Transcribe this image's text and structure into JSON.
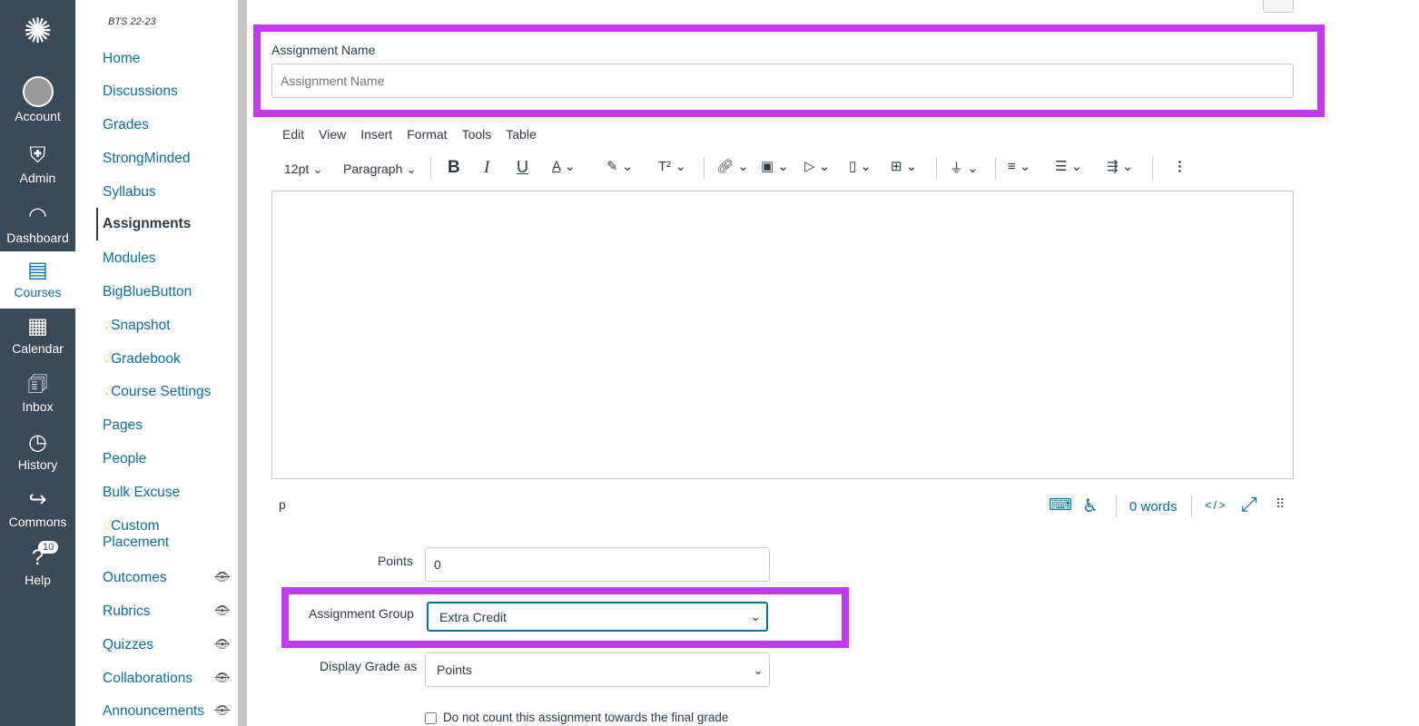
{
  "global_nav": [
    {
      "label": "Account",
      "icon": "avatar-icon"
    },
    {
      "label": "Admin",
      "icon": "shield-key-icon"
    },
    {
      "label": "Dashboard",
      "icon": "speedometer-icon"
    },
    {
      "label": "Courses",
      "icon": "book-icon",
      "active": true
    },
    {
      "label": "Calendar",
      "icon": "calendar-icon"
    },
    {
      "label": "Inbox",
      "icon": "inbox-icon"
    },
    {
      "label": "History",
      "icon": "clock-icon"
    },
    {
      "label": "Commons",
      "icon": "commons-icon"
    },
    {
      "label": "Help",
      "icon": "help-icon",
      "badge": "10"
    }
  ],
  "course": {
    "name": "BTS 22-23",
    "items": [
      {
        "label": "Home"
      },
      {
        "label": "Discussions"
      },
      {
        "label": "Grades"
      },
      {
        "label": "StrongMinded"
      },
      {
        "label": "Syllabus"
      },
      {
        "label": "Assignments",
        "active": true
      },
      {
        "label": "Modules"
      },
      {
        "label": "BigBlueButton"
      },
      {
        "label": "Snapshot",
        "bulb": true
      },
      {
        "label": "Gradebook",
        "bulb": true
      },
      {
        "label": "Course Settings",
        "bulb": true
      },
      {
        "label": "Pages"
      },
      {
        "label": "People"
      },
      {
        "label": "Bulk Excuse"
      },
      {
        "label": "Custom Placement",
        "bulb": true
      },
      {
        "label": "Outcomes",
        "hidden": true
      },
      {
        "label": "Rubrics",
        "hidden": true
      },
      {
        "label": "Quizzes",
        "hidden": true
      },
      {
        "label": "Collaborations",
        "hidden": true
      },
      {
        "label": "Announcements",
        "hidden": true
      }
    ]
  },
  "form": {
    "name_label": "Assignment Name",
    "name_placeholder": "Assignment Name",
    "name_value": "",
    "points_label": "Points",
    "points_value": "0",
    "group_label": "Assignment Group",
    "group_value": "Extra Credit",
    "display_label": "Display Grade as",
    "display_value": "Points",
    "exclude_label": "Do not count this assignment towards the final grade",
    "exclude_checked": false
  },
  "editor": {
    "menu": [
      "Edit",
      "View",
      "Insert",
      "Format",
      "Tools",
      "Table"
    ],
    "font_size": "12pt",
    "block": "Paragraph",
    "path": "p",
    "word_count": "0 words",
    "html_toggle": "</>"
  },
  "colors": {
    "highlight": "#c03bef",
    "nav_bg": "#394b58",
    "link": "#0770a3"
  }
}
